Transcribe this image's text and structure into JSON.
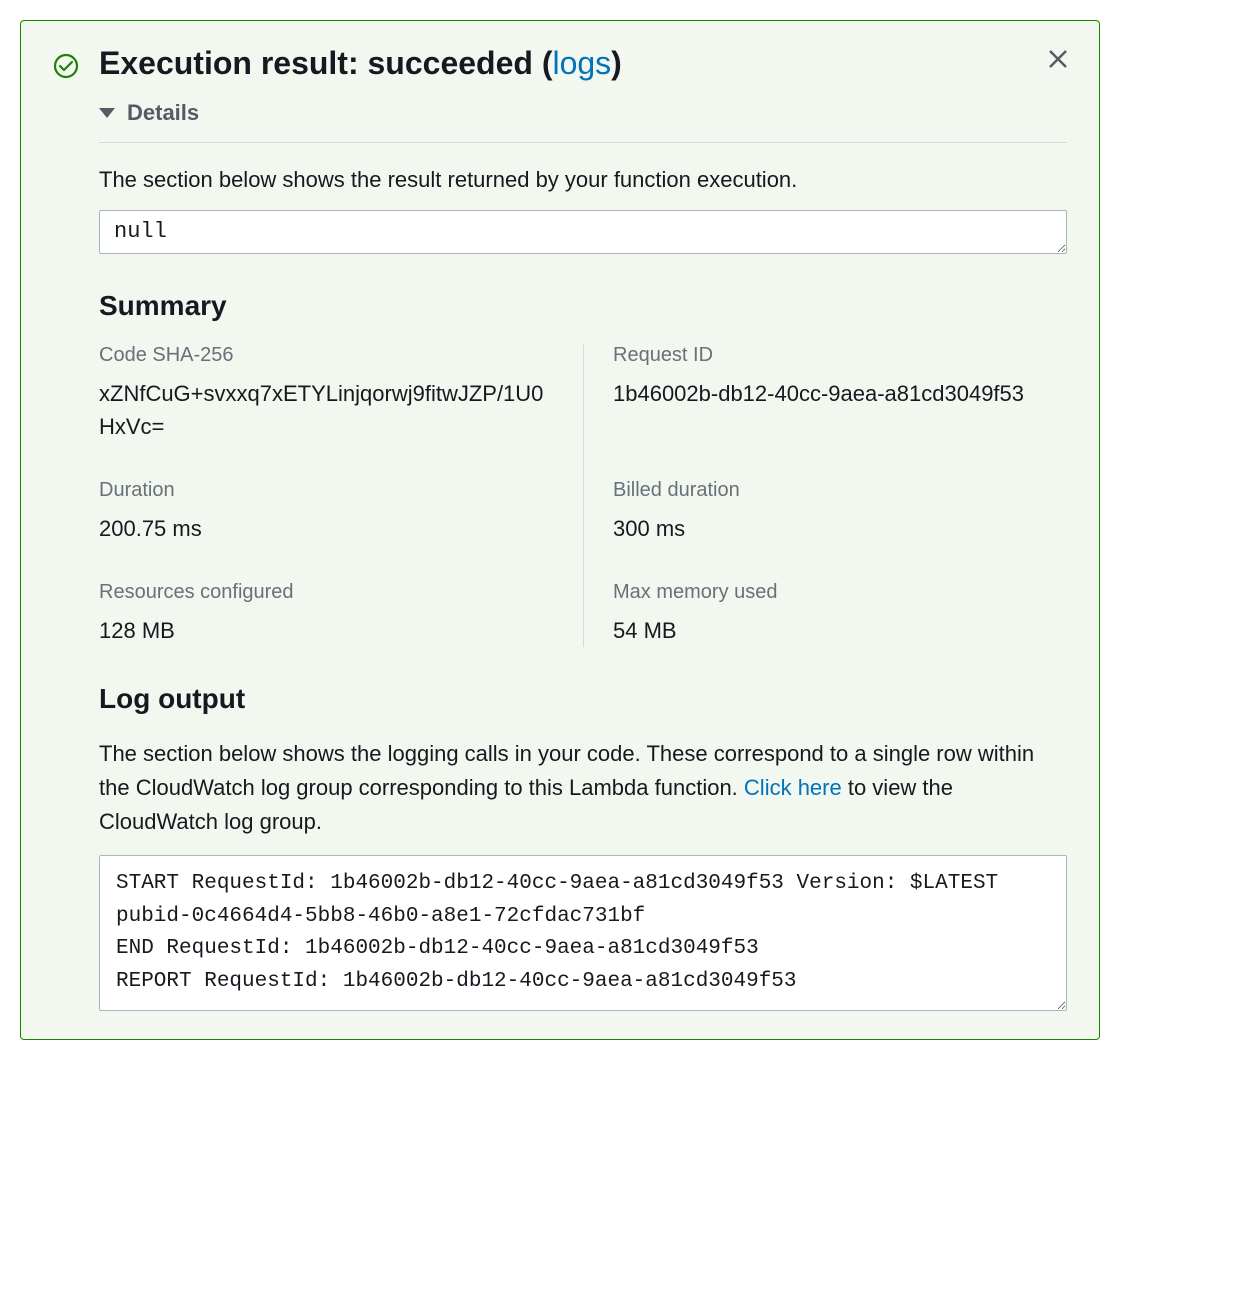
{
  "header": {
    "title_prefix": "Execution result: succeeded (",
    "logs_link": "logs",
    "title_suffix": ")"
  },
  "details": {
    "label": "Details",
    "result_description": "The section below shows the result returned by your function execution.",
    "result_value": "null"
  },
  "summary": {
    "title": "Summary",
    "items": [
      {
        "label": "Code SHA-256",
        "value": "xZNfCuG+svxxq7xETYLinjqorwj9fitwJZP/1U0HxVc="
      },
      {
        "label": "Request ID",
        "value": "1b46002b-db12-40cc-9aea-a81cd3049f53"
      },
      {
        "label": "Duration",
        "value": "200.75 ms"
      },
      {
        "label": "Billed duration",
        "value": "300 ms"
      },
      {
        "label": "Resources configured",
        "value": "128 MB"
      },
      {
        "label": "Max memory used",
        "value": "54 MB"
      }
    ]
  },
  "log": {
    "title": "Log output",
    "description_prefix": "The section below shows the logging calls in your code. These correspond to a single row within the CloudWatch log group corresponding to this Lambda function. ",
    "link_text": "Click here",
    "description_suffix": " to view the CloudWatch log group.",
    "content": "START RequestId: 1b46002b-db12-40cc-9aea-a81cd3049f53 Version: $LATEST\npubid-0c4664d4-5bb8-46b0-a8e1-72cfdac731bf\nEND RequestId: 1b46002b-db12-40cc-9aea-a81cd3049f53\nREPORT RequestId: 1b46002b-db12-40cc-9aea-a81cd3049f53"
  }
}
